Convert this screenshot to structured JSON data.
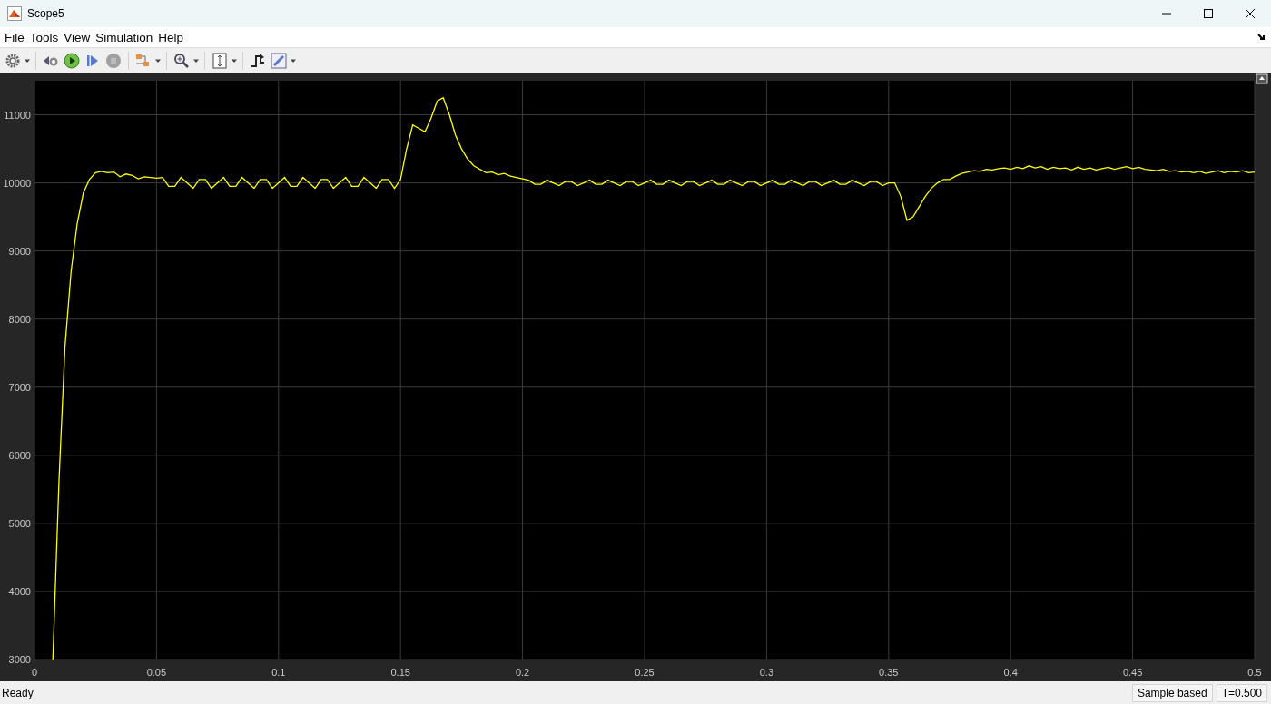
{
  "window": {
    "title": "Scope5"
  },
  "menu": [
    "File",
    "Tools",
    "View",
    "Simulation",
    "Help"
  ],
  "plot": {
    "chart_data": {
      "type": "line",
      "grid": true,
      "xlim": [
        0,
        0.5
      ],
      "ylim": [
        3000,
        11500
      ],
      "xticks": [
        0,
        0.05,
        0.1,
        0.15,
        0.2,
        0.25,
        0.3,
        0.35,
        0.4,
        0.45,
        0.5
      ],
      "yticks": [
        3000,
        4000,
        5000,
        6000,
        7000,
        8000,
        9000,
        10000,
        11000
      ],
      "x": [
        0.0075,
        0.01,
        0.0125,
        0.015,
        0.0175,
        0.02,
        0.0225,
        0.025,
        0.0275,
        0.03,
        0.0325,
        0.035,
        0.0375,
        0.04,
        0.0425,
        0.045,
        0.0475,
        0.05,
        0.0525,
        0.055,
        0.0575,
        0.06,
        0.0625,
        0.065,
        0.0675,
        0.07,
        0.0725,
        0.075,
        0.0775,
        0.08,
        0.0825,
        0.085,
        0.0875,
        0.09,
        0.0925,
        0.095,
        0.0975,
        0.1,
        0.1025,
        0.105,
        0.1075,
        0.11,
        0.1125,
        0.115,
        0.1175,
        0.12,
        0.1225,
        0.125,
        0.1275,
        0.13,
        0.1325,
        0.135,
        0.1375,
        0.14,
        0.1425,
        0.145,
        0.1475,
        0.15,
        0.1525,
        0.155,
        0.1575,
        0.16,
        0.1625,
        0.165,
        0.1675,
        0.17,
        0.1725,
        0.175,
        0.1775,
        0.18,
        0.1825,
        0.185,
        0.1875,
        0.19,
        0.1925,
        0.195,
        0.1975,
        0.2,
        0.2025,
        0.205,
        0.2075,
        0.21,
        0.2125,
        0.215,
        0.2175,
        0.22,
        0.2225,
        0.225,
        0.2275,
        0.23,
        0.2325,
        0.235,
        0.2375,
        0.24,
        0.2425,
        0.245,
        0.2475,
        0.25,
        0.2525,
        0.255,
        0.2575,
        0.26,
        0.2625,
        0.265,
        0.2675,
        0.27,
        0.2725,
        0.275,
        0.2775,
        0.28,
        0.2825,
        0.285,
        0.2875,
        0.29,
        0.2925,
        0.295,
        0.2975,
        0.3,
        0.3025,
        0.305,
        0.3075,
        0.31,
        0.3125,
        0.315,
        0.3175,
        0.32,
        0.3225,
        0.325,
        0.3275,
        0.33,
        0.3325,
        0.335,
        0.3375,
        0.34,
        0.3425,
        0.345,
        0.3475,
        0.35,
        0.3525,
        0.355,
        0.3575,
        0.36,
        0.3625,
        0.365,
        0.3675,
        0.37,
        0.3725,
        0.375,
        0.3775,
        0.38,
        0.3825,
        0.385,
        0.3875,
        0.39,
        0.3925,
        0.395,
        0.3975,
        0.4,
        0.4025,
        0.405,
        0.4075,
        0.41,
        0.4125,
        0.415,
        0.4175,
        0.42,
        0.4225,
        0.425,
        0.4275,
        0.43,
        0.4325,
        0.435,
        0.4375,
        0.44,
        0.4425,
        0.445,
        0.4475,
        0.45,
        0.4525,
        0.455,
        0.4575,
        0.46,
        0.4625,
        0.465,
        0.4675,
        0.47,
        0.4725,
        0.475,
        0.4775,
        0.48,
        0.4825,
        0.485,
        0.4875,
        0.49,
        0.4925,
        0.495,
        0.4975,
        0.5
      ],
      "series": [
        {
          "color": "#ffff00",
          "values": [
            3000,
            5600,
            7600,
            8700,
            9400,
            9850,
            10050,
            10150,
            10170,
            10150,
            10160,
            10090,
            10130,
            10110,
            10060,
            10090,
            10080,
            10070,
            10080,
            9950,
            9950,
            10080,
            10000,
            9920,
            10050,
            10050,
            9920,
            10000,
            10080,
            9950,
            9950,
            10080,
            10000,
            9920,
            10050,
            10050,
            9920,
            10000,
            10080,
            9950,
            9950,
            10080,
            10000,
            9920,
            10050,
            10050,
            9920,
            10000,
            10080,
            9950,
            9950,
            10080,
            10000,
            9920,
            10050,
            10050,
            9920,
            10050,
            10500,
            10850,
            10800,
            10750,
            10950,
            11200,
            11250,
            11000,
            10700,
            10500,
            10350,
            10250,
            10200,
            10150,
            10160,
            10120,
            10140,
            10100,
            10080,
            10060,
            10040,
            9980,
            9980,
            10040,
            10000,
            9960,
            10020,
            10020,
            9960,
            10000,
            10040,
            9980,
            9980,
            10040,
            10000,
            9960,
            10020,
            10020,
            9960,
            10000,
            10040,
            9980,
            9980,
            10040,
            10000,
            9960,
            10020,
            10020,
            9960,
            10000,
            10040,
            9980,
            9980,
            10040,
            10000,
            9960,
            10020,
            10020,
            9960,
            10000,
            10040,
            9980,
            9980,
            10040,
            10000,
            9960,
            10020,
            10020,
            9960,
            10000,
            10040,
            9980,
            9980,
            10040,
            10000,
            9960,
            10020,
            10020,
            9960,
            10000,
            10000,
            9800,
            9450,
            9500,
            9650,
            9800,
            9920,
            10000,
            10050,
            10050,
            10100,
            10140,
            10160,
            10180,
            10170,
            10200,
            10190,
            10210,
            10220,
            10200,
            10230,
            10210,
            10250,
            10220,
            10240,
            10200,
            10230,
            10210,
            10220,
            10190,
            10230,
            10200,
            10220,
            10190,
            10210,
            10230,
            10200,
            10220,
            10240,
            10210,
            10230,
            10200,
            10190,
            10180,
            10200,
            10170,
            10180,
            10160,
            10170,
            10150,
            10170,
            10140,
            10160,
            10180,
            10150,
            10170,
            10160,
            10180,
            10150,
            10160
          ]
        }
      ]
    }
  },
  "status_bar": {
    "message": "Ready",
    "sections": [
      "Sample based",
      "T=0.500"
    ]
  }
}
